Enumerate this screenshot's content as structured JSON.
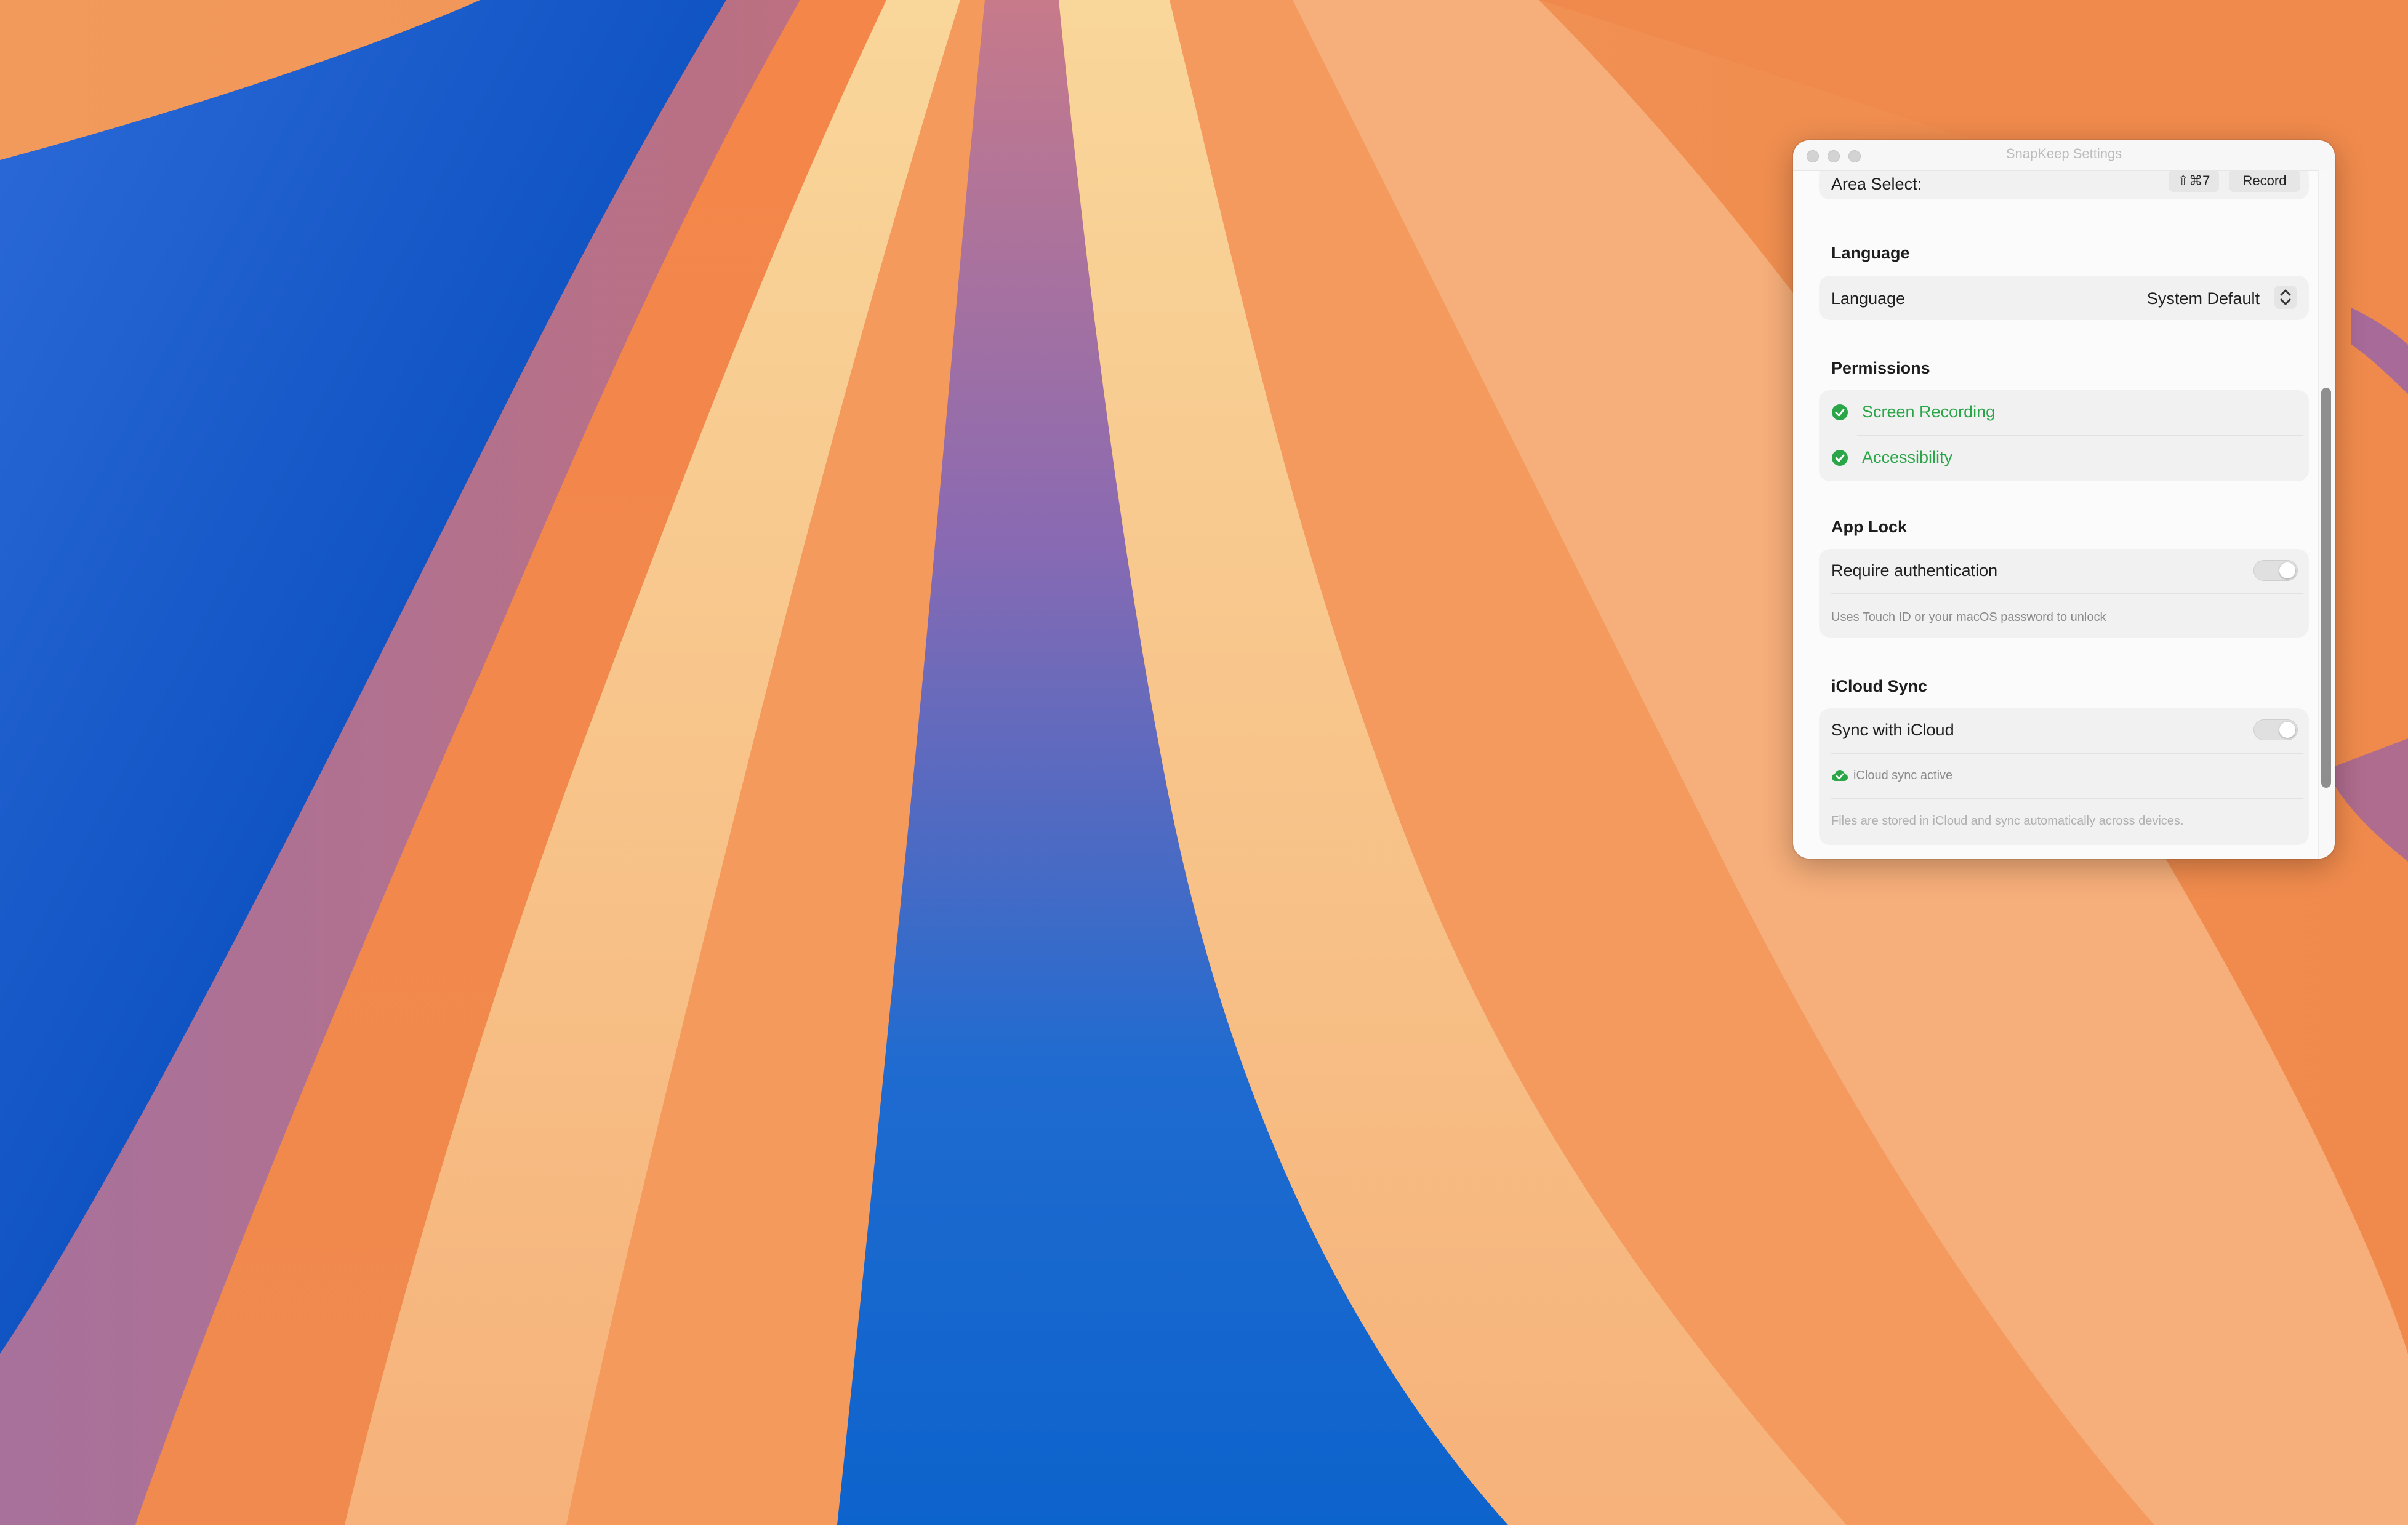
{
  "window": {
    "title": "SnapKeep Settings"
  },
  "shortcuts": {
    "area_select_label": "Area Select:",
    "area_select_keys": "⇧⌘7",
    "record_label": "Record"
  },
  "language": {
    "section_title": "Language",
    "row_label": "Language",
    "selected_value": "System Default"
  },
  "permissions": {
    "section_title": "Permissions",
    "items": [
      {
        "label": "Screen Recording",
        "icon": "check-circle-icon"
      },
      {
        "label": "Accessibility",
        "icon": "check-circle-icon"
      }
    ]
  },
  "app_lock": {
    "section_title": "App Lock",
    "row_label": "Require authentication",
    "toggle_on": false,
    "note": "Uses Touch ID or your macOS password to unlock"
  },
  "icloud": {
    "section_title": "iCloud Sync",
    "row_label": "Sync with iCloud",
    "toggle_on": false,
    "status": "iCloud sync active",
    "status_icon": "cloud-check-icon",
    "note": "Files are stored in iCloud and sync automatically across devices."
  },
  "colors": {
    "success_green": "#2aa648",
    "window_bg": "#fbfbfb",
    "card_bg": "#f1f1f1"
  }
}
